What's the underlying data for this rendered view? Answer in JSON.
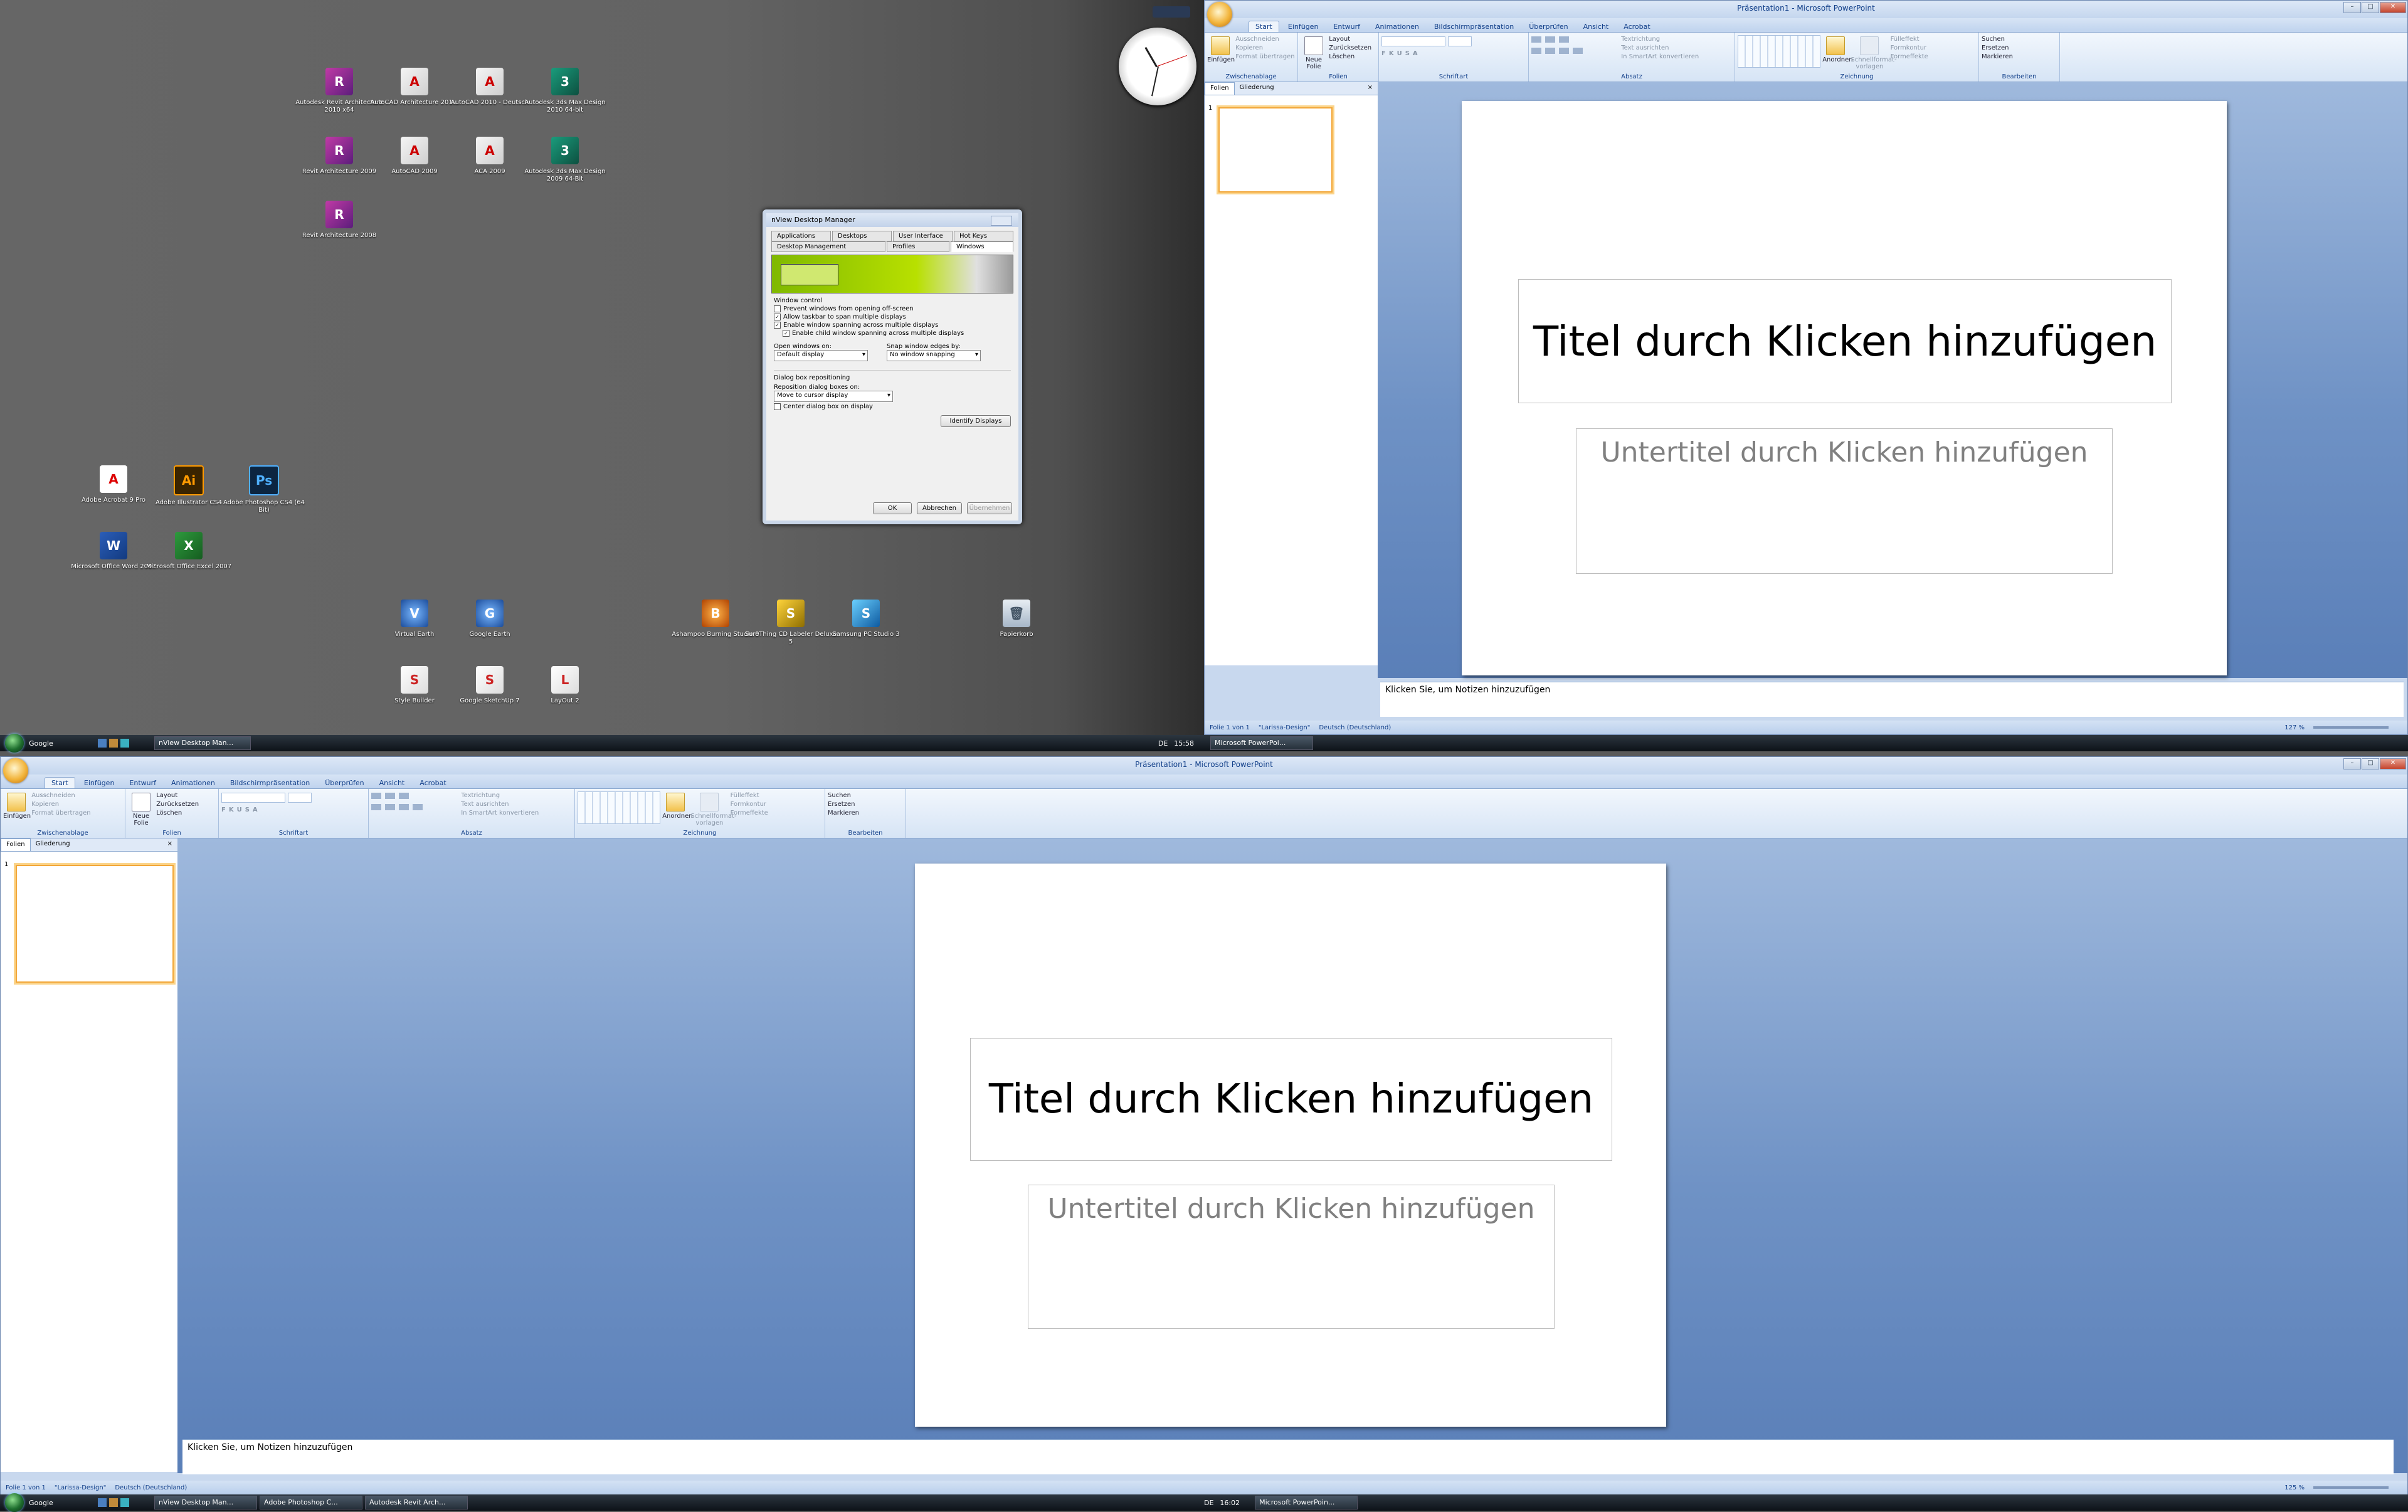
{
  "desktop": {
    "icons": [
      {
        "label": "Autodesk Revit Architecture 2010 x64",
        "glyph": "R",
        "cls": "ic-revit"
      },
      {
        "label": "AutoCAD Architecture 201…",
        "glyph": "A",
        "cls": "ic-acad"
      },
      {
        "label": "AutoCAD 2010 - Deutsch",
        "glyph": "A",
        "cls": "ic-acad"
      },
      {
        "label": "Autodesk 3ds Max Design 2010 64-bit",
        "glyph": "3",
        "cls": "ic-3ds"
      },
      {
        "label": "Revit Architecture 2009",
        "glyph": "R",
        "cls": "ic-revit"
      },
      {
        "label": "AutoCAD 2009",
        "glyph": "A",
        "cls": "ic-acad"
      },
      {
        "label": "ACA 2009",
        "glyph": "A",
        "cls": "ic-acad"
      },
      {
        "label": "Autodesk 3ds Max Design 2009 64-Bit",
        "glyph": "3",
        "cls": "ic-3ds"
      },
      {
        "label": "Revit Architecture 2008",
        "glyph": "R",
        "cls": "ic-revit"
      },
      {
        "label": "Adobe Acrobat 9 Pro",
        "glyph": "A",
        "cls": "ic-pdf"
      },
      {
        "label": "Adobe Illustrator CS4",
        "glyph": "Ai",
        "cls": "ic-ai"
      },
      {
        "label": "Adobe Photoshop CS4 (64 Bit)",
        "glyph": "Ps",
        "cls": "ic-ps"
      },
      {
        "label": "Microsoft Office Word 2007",
        "glyph": "W",
        "cls": "ic-word"
      },
      {
        "label": "Microsoft Office Excel 2007",
        "glyph": "X",
        "cls": "ic-excel"
      },
      {
        "label": "Virtual Earth",
        "glyph": "V",
        "cls": "ic-earth"
      },
      {
        "label": "Google Earth",
        "glyph": "G",
        "cls": "ic-earth"
      },
      {
        "label": "Ashampoo Burning Studio 9",
        "glyph": "B",
        "cls": "ic-burn"
      },
      {
        "label": "SureThing CD Labeler Deluxe 5",
        "glyph": "S",
        "cls": "ic-label"
      },
      {
        "label": "Samsung PC Studio 3",
        "glyph": "S",
        "cls": "ic-samsung"
      },
      {
        "label": "Papierkorb",
        "glyph": "🗑",
        "cls": "ic-trash"
      },
      {
        "label": "Style Builder",
        "glyph": "S",
        "cls": "ic-sketch"
      },
      {
        "label": "Google SketchUp 7",
        "glyph": "S",
        "cls": "ic-sketch"
      },
      {
        "label": "LayOut 2",
        "glyph": "L",
        "cls": "ic-sketch"
      }
    ]
  },
  "nview": {
    "title": "nView Desktop Manager",
    "tabs_row1": [
      "Applications",
      "Desktops",
      "User Interface",
      "Hot Keys"
    ],
    "tabs_row2": [
      "Desktop Management",
      "Profiles",
      "Windows"
    ],
    "window_control_label": "Window control",
    "checks": [
      {
        "label": "Prevent windows from opening off-screen",
        "checked": false
      },
      {
        "label": "Allow taskbar to span multiple displays",
        "checked": true
      },
      {
        "label": "Enable window spanning across multiple displays",
        "checked": true
      },
      {
        "label": "Enable child window spanning across multiple displays",
        "checked": true
      }
    ],
    "open_on_label": "Open windows on:",
    "open_on_value": "Default display",
    "snap_label": "Snap window edges by:",
    "snap_value": "No window snapping",
    "dialog_group_label": "Dialog box repositioning",
    "reposition_label": "Reposition dialog boxes on:",
    "reposition_value": "Move to cursor display",
    "center_label": "Center dialog box on display",
    "identify_button": "Identify Displays",
    "ok": "OK",
    "cancel": "Abbrechen",
    "apply": "Übernehmen"
  },
  "taskbar_top": {
    "search_label": "Google",
    "tasks": [
      "nView Desktop Man..."
    ],
    "lang": "DE",
    "time": "15:58",
    "tasks_right": [
      "Microsoft PowerPoi..."
    ]
  },
  "taskbar_bottom": {
    "search_label": "Google",
    "tasks": [
      "nView Desktop Man...",
      "Adobe Photoshop C...",
      "Autodesk Revit Arch..."
    ],
    "lang": "DE",
    "time": "16:02",
    "tasks_right": [
      "Microsoft PowerPoin..."
    ]
  },
  "ppt": {
    "window_title": "Präsentation1 - Microsoft PowerPoint",
    "tabs": [
      "Start",
      "Einfügen",
      "Entwurf",
      "Animationen",
      "Bildschirmpräsentation",
      "Überprüfen",
      "Ansicht",
      "Acrobat"
    ],
    "clipboard": {
      "paste": "Einfügen",
      "cut": "Ausschneiden",
      "copy": "Kopieren",
      "format": "Format übertragen",
      "label": "Zwischenablage"
    },
    "slides": {
      "new": "Neue Folie",
      "layout": "Layout",
      "reset": "Zurücksetzen",
      "delete": "Löschen",
      "label": "Folien"
    },
    "font_label": "Schriftart",
    "paragraph": {
      "direction": "Textrichtung",
      "align": "Text ausrichten",
      "smartart": "In SmartArt konvertieren",
      "label": "Absatz"
    },
    "drawing": {
      "arrange": "Anordnen",
      "quickstyles": "Schnellformat-vorlagen",
      "fill": "Fülleffekt",
      "outline": "Formkontur",
      "effects": "Formeffekte",
      "label": "Zeichnung"
    },
    "editing": {
      "find": "Suchen",
      "replace": "Ersetzen",
      "select": "Markieren",
      "label": "Bearbeiten"
    },
    "pane_tabs": [
      "Folien",
      "Gliederung"
    ],
    "slide_number": "1",
    "title_placeholder": "Titel durch Klicken hinzufügen",
    "subtitle_placeholder": "Untertitel durch Klicken hinzufügen",
    "notes_placeholder": "Klicken Sie, um Notizen hinzuzufügen",
    "status": {
      "slide": "Folie 1 von 1",
      "theme": "\"Larissa-Design\"",
      "language": "Deutsch (Deutschland)"
    },
    "zoom_top": "127 %",
    "zoom_bottom": "125 %"
  }
}
